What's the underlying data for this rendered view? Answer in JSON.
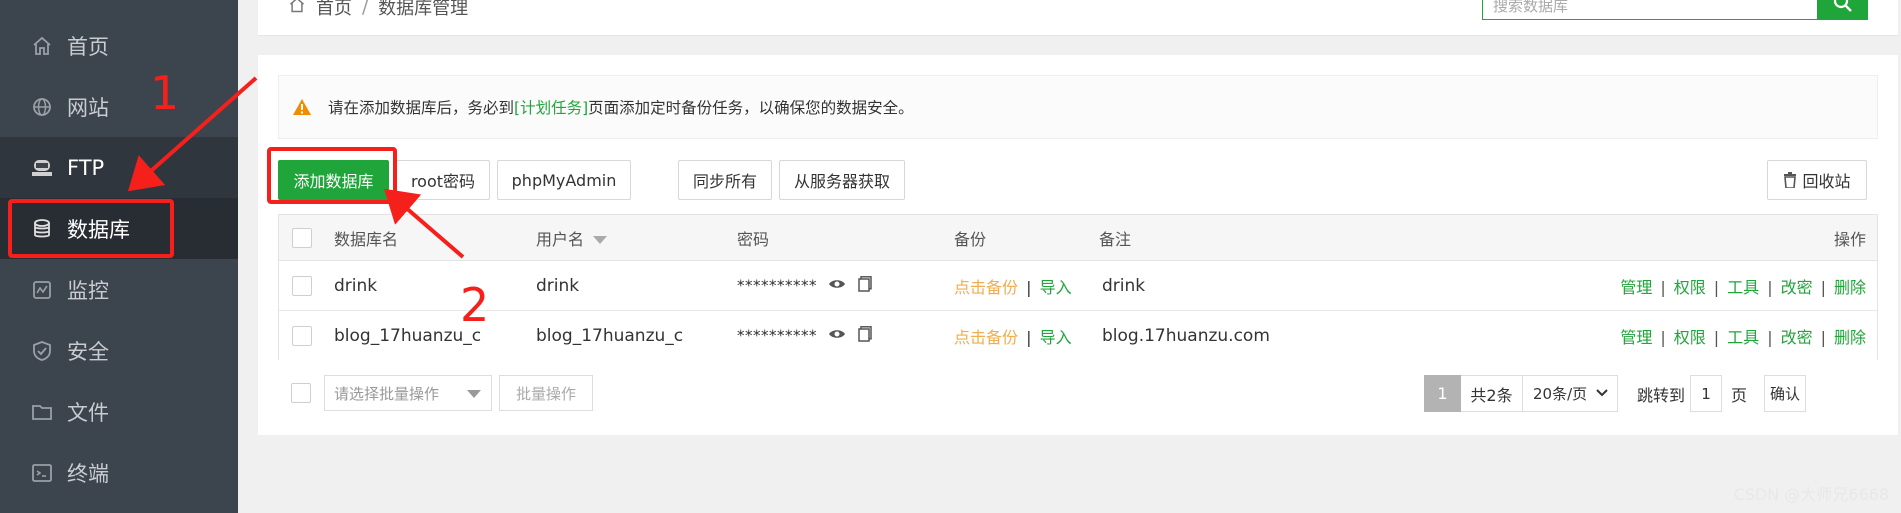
{
  "sidebar": {
    "items": [
      {
        "label": "首页",
        "icon": "home-icon"
      },
      {
        "label": "网站",
        "icon": "globe-icon"
      },
      {
        "label": "FTP",
        "icon": "ftp-icon"
      },
      {
        "label": "数据库",
        "icon": "database-icon"
      },
      {
        "label": "监控",
        "icon": "monitor-icon"
      },
      {
        "label": "安全",
        "icon": "shield-icon"
      },
      {
        "label": "文件",
        "icon": "folder-icon"
      },
      {
        "label": "终端",
        "icon": "terminal-icon"
      }
    ]
  },
  "breadcrumb": {
    "home": "首页",
    "separator": "/",
    "current": "数据库管理"
  },
  "search": {
    "placeholder": "搜索数据库"
  },
  "notice": {
    "before": "请在添加数据库后，务必到",
    "link": "[计划任务]",
    "after": "页面添加定时备份任务，以确保您的数据安全。"
  },
  "toolbar": {
    "add": "添加数据库",
    "root": "root密码",
    "pma": "phpMyAdmin",
    "sync": "同步所有",
    "fetch": "从服务器获取",
    "recycle": "回收站"
  },
  "table": {
    "headers": {
      "name": "数据库名",
      "user": "用户名",
      "password": "密码",
      "backup": "备份",
      "note": "备注",
      "actions": "操作"
    },
    "rows": [
      {
        "name": "drink",
        "user": "drink",
        "password": "**********",
        "backup": "点击备份",
        "import": "导入",
        "note": "drink"
      },
      {
        "name": "blog_17huanzu_c",
        "user": "blog_17huanzu_c",
        "password": "**********",
        "backup": "点击备份",
        "import": "导入",
        "note": "blog.17huanzu.com"
      }
    ],
    "actions": [
      "管理",
      "权限",
      "工具",
      "改密",
      "删除"
    ],
    "sep": "|"
  },
  "bulk": {
    "placeholder": "请选择批量操作",
    "button": "批量操作"
  },
  "pagination": {
    "current": "1",
    "total": "共2条",
    "size": "20条/页",
    "jump_label": "跳转到",
    "jump_value": "1",
    "page_suffix": "页",
    "confirm": "确认"
  },
  "annotations": {
    "one": "1",
    "two": "2",
    "color": "#f5201c"
  },
  "watermark": "CSDN @大师兄6668",
  "colors": {
    "accent": "#20a53a",
    "sidebar": "#3c444d",
    "warning": "#f0ad4e"
  }
}
